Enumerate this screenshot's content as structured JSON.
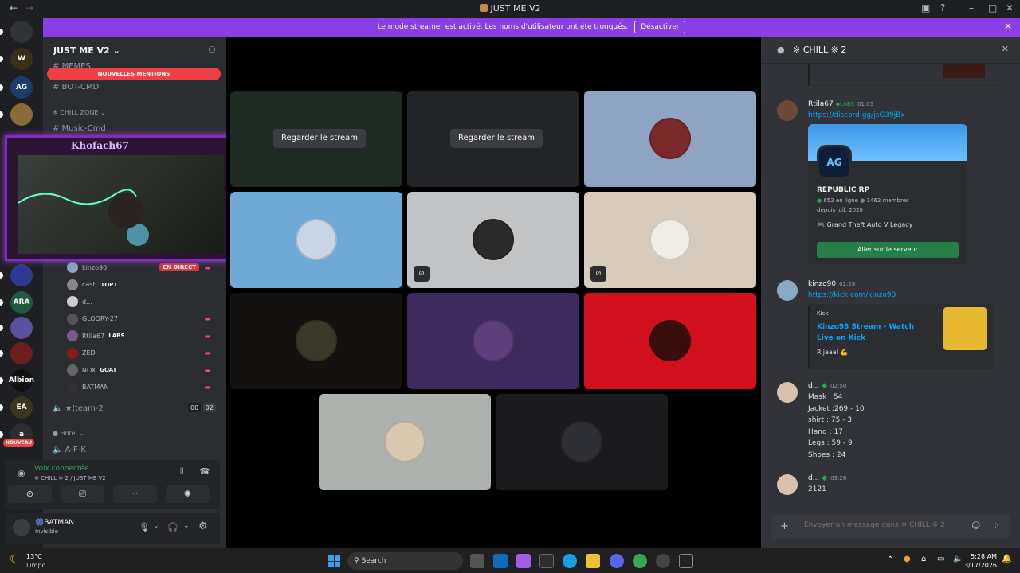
{
  "window": {
    "title": "JUST ME V2"
  },
  "banner": {
    "text": "Le mode streamer est activé. Les noms d'utilisateur ont été tronqués.",
    "button": "Désactiver"
  },
  "rail": [
    {
      "label": "",
      "badge": "17",
      "color": "#313338"
    },
    {
      "label": "W",
      "badge": "1",
      "color": "#3a2f1a"
    },
    {
      "label": "AG",
      "badge": "1",
      "color": "#1b3d6e"
    },
    {
      "label": "",
      "badge": "2",
      "color": "#8a6b3a"
    },
    {
      "label": "",
      "badge": "64",
      "color": "#2d3a8f"
    },
    {
      "label": "ARA",
      "badge": "1K+",
      "color": "#1f5a3f"
    },
    {
      "label": "",
      "badge": "34",
      "color": "#5b4fa0"
    },
    {
      "label": "",
      "badge": "22",
      "color": "#6b1f1f"
    },
    {
      "label": "Albion",
      "badge": "",
      "color": "#111"
    },
    {
      "label": "EA",
      "badge": "",
      "color": "#3a3520"
    },
    {
      "label": "a",
      "badge": "",
      "color": "#2b2d31"
    }
  ],
  "rail_new": "NOUVEAU",
  "sidebar": {
    "server_name": "JUST ME V2",
    "new_mentions": "NOUVELLES MENTIONS",
    "channels": {
      "memes": "MEMES",
      "bot_cmd": "BOT-CMD",
      "category_chill": "CHILL ZONE",
      "music": "Music-Cmd",
      "team2": "★¦team-2",
      "team2_count_a": "00",
      "team2_count_b": "02",
      "category_hotel": "Hotel",
      "afk": "A-F-K"
    },
    "voice_users": [
      {
        "name": "kinzo90",
        "tag": "EN DIRECT"
      },
      {
        "name": "cash",
        "tag": "TOP1"
      },
      {
        "name": "d...",
        "tag": ""
      },
      {
        "name": "GLOORY-27",
        "tag": ""
      },
      {
        "name": "Rtila67",
        "tag": "LABS"
      },
      {
        "name": "ZED",
        "tag": ""
      },
      {
        "name": "NOX",
        "tag": "GOAT"
      },
      {
        "name": "BATMAN",
        "tag": ""
      }
    ],
    "webcam_name": "Khofach67",
    "voice_status": "Voix connectée",
    "voice_channel": "※ CHILL ※ 2 / JUST ME V2",
    "user": {
      "name": "BATMAN",
      "status": "Invisible"
    }
  },
  "stage": {
    "watch_label": "Regarder le stream",
    "tiles": [
      {
        "kind": "stream",
        "bg": "#1f2a22"
      },
      {
        "kind": "stream",
        "bg": "#232428"
      },
      {
        "kind": "avatar",
        "bg": "#8fa3c3",
        "avatar": "#7a2a2a"
      },
      {
        "kind": "avatar",
        "bg": "#6fa9d6",
        "avatar": "#c9d6e6"
      },
      {
        "kind": "avatar",
        "bg": "#c2c3c5",
        "avatar": "#2a2a2a",
        "muted": true
      },
      {
        "kind": "avatar",
        "bg": "#d6cbbd",
        "avatar": "#f0ece6",
        "muted": true
      },
      {
        "kind": "avatar",
        "bg": "#141210",
        "avatar": "#3a3a2a"
      },
      {
        "kind": "avatar",
        "bg": "#3e2a5e",
        "avatar": "#5e3f7e"
      },
      {
        "kind": "avatar",
        "bg": "#d0101c",
        "avatar": "#3a0d0d"
      },
      {
        "kind": "avatar",
        "bg": "#adb1ae",
        "avatar": "#d9c8b0"
      },
      {
        "kind": "avatar",
        "bg": "#1b1b1d",
        "avatar": "#2f2f36"
      }
    ]
  },
  "chat": {
    "title": "※ CHILL ※ 2",
    "messages": [
      {
        "name": "Rtila67",
        "tag": "LABS",
        "time": "01:05",
        "link": "https://discord.gg/jsG39jBx",
        "invite": {
          "name": "REPUBLIC RP",
          "online": "652 en ligne",
          "members": "1462 membres",
          "since": "depuis juil. 2020",
          "game": "Grand Theft Auto V Legacy",
          "button": "Aller sur le serveur"
        }
      },
      {
        "name": "kinzo90",
        "time": "02:28",
        "link": "https://kick.com/kinzo93",
        "embed": {
          "provider": "Kick",
          "title": "Kinzo93 Stream - Watch Live on Kick",
          "desc": "Rijaaal 💪"
        }
      },
      {
        "name": "d...",
        "time": "02:50",
        "lines": [
          "Mask : 54",
          "Jacket :269 - 10",
          "shirt : 75  - 3",
          "Hand : 17",
          "Legs : 59 - 9",
          "Shoes : 24"
        ]
      },
      {
        "name": "d...",
        "time": "03:26",
        "lines": [
          "2121"
        ]
      }
    ],
    "composer_placeholder": "Envoyer un message dans ※ CHILL ※ 2"
  },
  "taskbar": {
    "weather_temp": "13°C",
    "weather_desc": "Limpo",
    "search": "Search",
    "time": "5:28 AM",
    "date": "3/17/2026"
  }
}
